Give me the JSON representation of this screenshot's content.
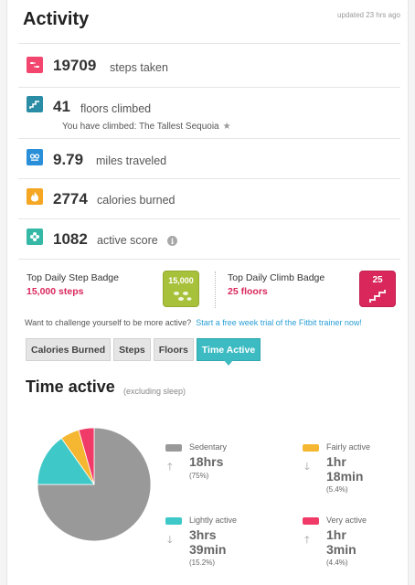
{
  "header": {
    "title": "Activity",
    "updated": "updated 23 hrs ago"
  },
  "stats": {
    "steps": {
      "value": "19709",
      "label": "steps taken",
      "icon": "steps-icon",
      "color": "#f2466e"
    },
    "floors": {
      "value": "41",
      "label": "floors climbed",
      "icon": "stairs-icon",
      "color": "#2b8da5",
      "sub": "You have climbed: The Tallest Sequoia"
    },
    "miles": {
      "value": "9.79",
      "label": "miles traveled",
      "icon": "footprints-icon",
      "color": "#2a8fd9"
    },
    "calories": {
      "value": "2774",
      "label": "calories burned",
      "icon": "flame-icon",
      "color": "#f5a623"
    },
    "active": {
      "value": "1082",
      "label": "active score",
      "icon": "flower-icon",
      "color": "#35b8a6"
    }
  },
  "badges": {
    "step": {
      "title": "Top Daily Step Badge",
      "value": "15,000 steps",
      "badge_text": "15,000",
      "color": "#a8c13b"
    },
    "climb": {
      "title": "Top Daily Climb Badge",
      "value": "25 floors",
      "badge_text": "25",
      "color": "#d9275c"
    }
  },
  "challenge": {
    "text": "Want to challenge yourself to be more active?",
    "link": "Start a free week trial of the Fitbit trainer now!"
  },
  "tabs": [
    {
      "label": "Calories Burned",
      "active": false
    },
    {
      "label": "Steps",
      "active": false
    },
    {
      "label": "Floors",
      "active": false
    },
    {
      "label": "Time Active",
      "active": true
    }
  ],
  "time_active": {
    "title": "Time active",
    "subtitle": "(excluding sleep)",
    "legend": [
      {
        "name": "Sedentary",
        "duration": [
          "18hrs"
        ],
        "pct": "(75%)",
        "color": "#999999",
        "trend": "up"
      },
      {
        "name": "Fairly active",
        "duration": [
          "1hr",
          "18min"
        ],
        "pct": "(5.4%)",
        "color": "#f5b731",
        "trend": "down"
      },
      {
        "name": "Lightly active",
        "duration": [
          "3hrs",
          "39min"
        ],
        "pct": "(15.2%)",
        "color": "#3ec8c8",
        "trend": "down"
      },
      {
        "name": "Very active",
        "duration": [
          "1hr",
          "3min"
        ],
        "pct": "(4.4%)",
        "color": "#f03a67",
        "trend": "up"
      }
    ]
  },
  "chart_data": {
    "type": "pie",
    "categories": [
      "Sedentary",
      "Lightly active",
      "Fairly active",
      "Very active"
    ],
    "values": [
      75,
      15.2,
      5.4,
      4.4
    ],
    "colors": [
      "#999999",
      "#3ec8c8",
      "#f5b731",
      "#f03a67"
    ],
    "title": "Time active"
  }
}
